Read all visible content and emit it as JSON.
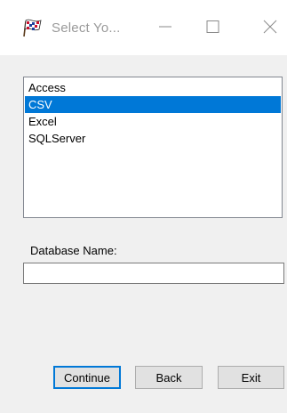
{
  "window": {
    "title": "Select Yo...",
    "icon": "checkered-flag-icon",
    "controls": [
      "minimize-icon",
      "maximize-icon",
      "close-icon"
    ]
  },
  "listbox": {
    "items": [
      {
        "label": "Access",
        "selected": false
      },
      {
        "label": "CSV",
        "selected": true
      },
      {
        "label": "Excel",
        "selected": false
      },
      {
        "label": "SQLServer",
        "selected": false
      }
    ]
  },
  "database": {
    "label": "Database Name:",
    "value": ""
  },
  "buttons": {
    "continue": "Continue",
    "back": "Back",
    "exit": "Exit"
  },
  "colors": {
    "selection": "#0078d7",
    "window_bg": "#f0f0f0",
    "title_text": "#9a9a9a"
  }
}
